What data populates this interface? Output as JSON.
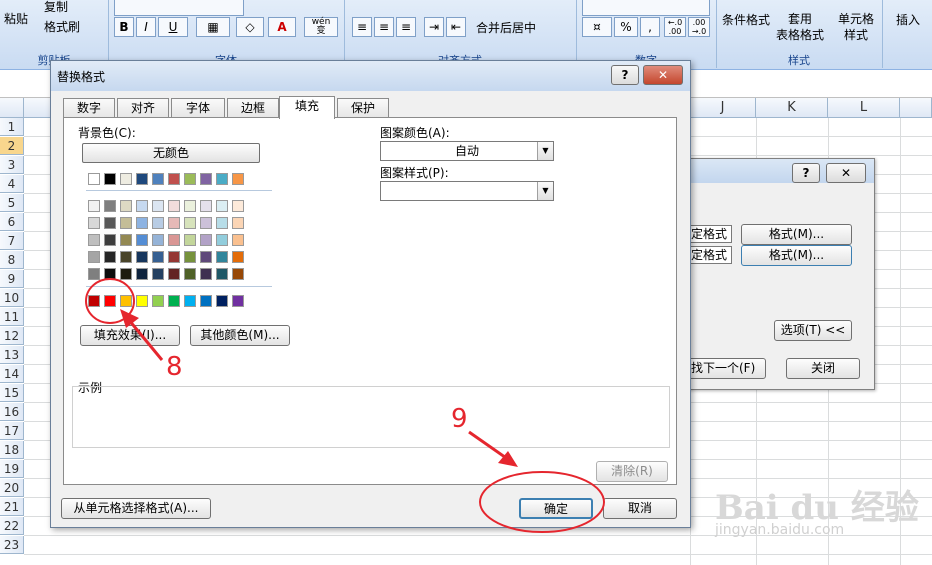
{
  "ribbon": {
    "paste": "粘贴",
    "copy": "复制",
    "format_painter": "格式刷",
    "clipboard_group": "剪贴板",
    "font_group": "字体",
    "align_group": "对齐方式",
    "number_group": "数字",
    "styles_group": "样式",
    "bold": "B",
    "italic": "I",
    "underline": "U",
    "font_color_glyph": "A",
    "wen_glyph": "wén\n变",
    "merge_center": "合并后居中",
    "percent": "%",
    "comma": ",",
    "dec_inc": "←.0\n.00",
    "dec_dec": ".00\n→.0",
    "cond_format": "条件格式",
    "table_format": "套用\n表格格式",
    "cell_styles": "单元格\n样式",
    "insert": "插入"
  },
  "sheet": {
    "columns": [
      "J",
      "K",
      "L"
    ],
    "rows": [
      "1",
      "2",
      "3",
      "4",
      "5",
      "6",
      "7",
      "8",
      "9",
      "10",
      "11",
      "12",
      "13",
      "14",
      "15",
      "16",
      "17",
      "18",
      "19",
      "20",
      "21",
      "22",
      "23"
    ],
    "selected_row": "2"
  },
  "back_dialog": {
    "help": "?",
    "close": "✕",
    "spec_format_1": "定格式",
    "spec_format_2": "定格式",
    "format_btn_1": "格式(M)...",
    "format_btn_2": "格式(M)...",
    "options_btn": "选项(T) <<",
    "find_next": "找下一个(F)",
    "close_btn": "关闭"
  },
  "dialog": {
    "title": "替换格式",
    "help": "?",
    "close": "✕",
    "tabs": [
      "数字",
      "对齐",
      "字体",
      "边框",
      "填充",
      "保护"
    ],
    "active_tab": "填充",
    "bg_color_label": "背景色(C):",
    "no_color": "无颜色",
    "fill_effects": "填充效果(I)...",
    "more_colors": "其他颜色(M)...",
    "pattern_color_label": "图案颜色(A):",
    "pattern_color_value": "自动",
    "pattern_style_label": "图案样式(P):",
    "pattern_style_value": "",
    "sample_label": "示例",
    "clear": "清除(R)",
    "from_cell": "从单元格选择格式(A)...",
    "ok": "确定",
    "cancel": "取消"
  },
  "palette": {
    "row0": [
      "#ffffff",
      "#000000",
      "#eeece1",
      "#1f497d",
      "#4f81bd",
      "#c0504d",
      "#9bbb59",
      "#8064a2",
      "#4bacc6",
      "#f79646"
    ],
    "rows": [
      [
        "#f2f2f2",
        "#7f7f7f",
        "#ddd9c3",
        "#c6d9f0",
        "#dbe5f1",
        "#f2dcdb",
        "#ebf1dd",
        "#e5e0ec",
        "#dbeef3",
        "#fdeada"
      ],
      [
        "#d8d8d8",
        "#595959",
        "#c4bd97",
        "#8db3e2",
        "#b8cce4",
        "#e5b9b7",
        "#d7e3bc",
        "#ccc1d9",
        "#b7dde8",
        "#fbd5b5"
      ],
      [
        "#bfbfbf",
        "#3f3f3f",
        "#938953",
        "#548dd4",
        "#95b3d7",
        "#d99694",
        "#c3d69b",
        "#b2a2c7",
        "#92cddc",
        "#fac08f"
      ],
      [
        "#a5a5a5",
        "#262626",
        "#494429",
        "#17365d",
        "#366092",
        "#953734",
        "#76923c",
        "#5f497a",
        "#31859b",
        "#e36c09"
      ],
      [
        "#7f7f7f",
        "#0c0c0c",
        "#1d1b10",
        "#0f243e",
        "#244061",
        "#632423",
        "#4f6128",
        "#3f3151",
        "#205867",
        "#974806"
      ]
    ],
    "standard": [
      "#c00000",
      "#ff0000",
      "#ffc000",
      "#ffff00",
      "#92d050",
      "#00b050",
      "#00b0f0",
      "#0070c0",
      "#002060",
      "#7030a0"
    ]
  },
  "annotations": {
    "step8": "8",
    "step9": "9",
    "color": "#e5262e"
  },
  "watermark": {
    "main": "Bai du 经验",
    "sub": "jingyan.baidu.com"
  }
}
